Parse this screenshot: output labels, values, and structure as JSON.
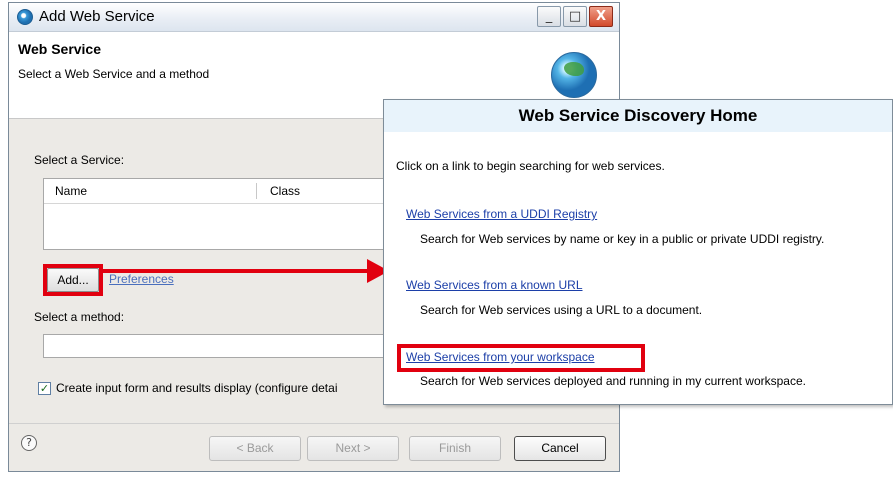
{
  "dialog": {
    "title": "Add Web Service",
    "window_controls": {
      "minimize": "_",
      "maximize": "□",
      "close": "X"
    },
    "header": {
      "title": "Web Service",
      "subtitle": "Select a Web Service and a method",
      "icon": "globe-icon"
    },
    "service_section": {
      "label": "Select a Service:",
      "columns": [
        "Name",
        "Class"
      ]
    },
    "add_button": "Add...",
    "preferences_link": "Preferences",
    "method_section": {
      "label": "Select a method:",
      "value": ""
    },
    "checkbox": {
      "checked": true,
      "label": "Create input form and results display (configure detai"
    },
    "footer": {
      "help_symbol": "?",
      "back": "< Back",
      "next": "Next >",
      "finish": "Finish",
      "cancel": "Cancel"
    }
  },
  "discovery": {
    "title": "Web Service Discovery Home",
    "intro": "Click on a link to begin searching for web services.",
    "links": [
      {
        "label": "Web Services from a UDDI Registry",
        "description": "Search for Web services by name or key in a public or private UDDI registry."
      },
      {
        "label": "Web Services from a known URL",
        "description": "Search for Web services using a URL to a document."
      },
      {
        "label": "Web Services from your workspace",
        "description": "Search for Web services deployed and running in my current workspace."
      }
    ]
  },
  "colors": {
    "highlight": "#e1000f",
    "link": "#1c3fa8",
    "panel_header": "#e8f3fb"
  }
}
